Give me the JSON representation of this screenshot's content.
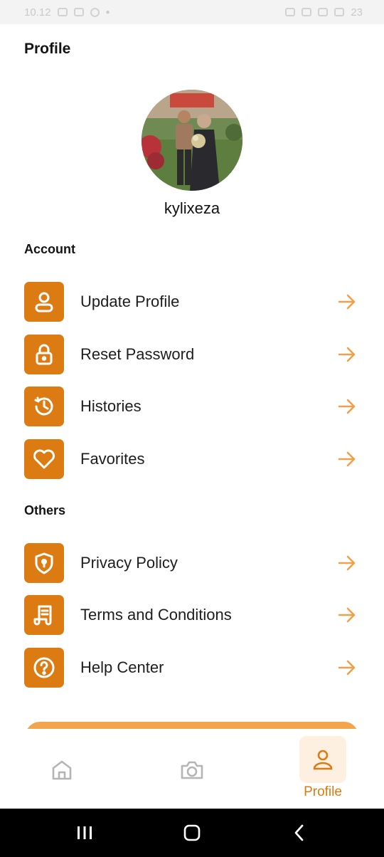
{
  "status_bar": {
    "time": "10.12",
    "icons_left": [
      "gallery-icon",
      "bug-icon",
      "clock-icon",
      "dot-icon"
    ],
    "icons_right": [
      "alarm-icon",
      "network-icon",
      "wifi-icon",
      "signal-icon",
      "battery-icon"
    ],
    "battery": "23"
  },
  "header": {
    "title": "Profile"
  },
  "profile": {
    "username": "kylixeza"
  },
  "sections": [
    {
      "title": "Account",
      "items": [
        {
          "label": "Update Profile",
          "icon": "user-icon"
        },
        {
          "label": "Reset Password",
          "icon": "lock-icon"
        },
        {
          "label": "Histories",
          "icon": "history-icon"
        },
        {
          "label": "Favorites",
          "icon": "heart-icon"
        }
      ]
    },
    {
      "title": "Others",
      "items": [
        {
          "label": "Privacy Policy",
          "icon": "shield-icon"
        },
        {
          "label": "Terms and Conditions",
          "icon": "document-icon"
        },
        {
          "label": "Help Center",
          "icon": "help-icon"
        }
      ]
    }
  ],
  "bottom_nav": {
    "items": [
      {
        "name": "home",
        "icon": "home-icon",
        "label": ""
      },
      {
        "name": "camera",
        "icon": "camera-icon",
        "label": ""
      },
      {
        "name": "profile",
        "icon": "profile-icon",
        "label": "Profile",
        "active": true
      }
    ]
  },
  "colors": {
    "accent": "#dc7b12",
    "arrow": "#f0a04b",
    "active_nav_bg": "#fdf0e1",
    "inactive_icon": "#b5b5b5"
  }
}
